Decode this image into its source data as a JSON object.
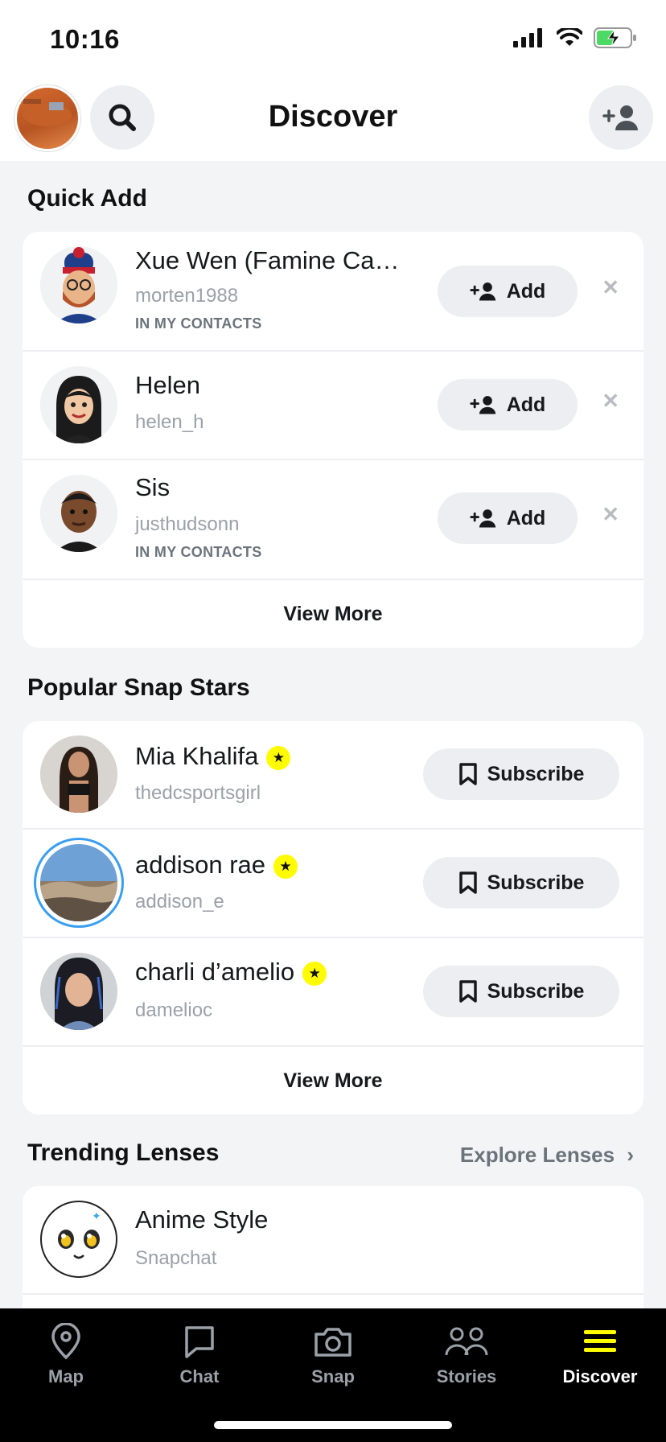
{
  "status": {
    "time": "10:16"
  },
  "header": {
    "title": "Discover"
  },
  "quick_add": {
    "title": "Quick Add",
    "items": [
      {
        "name": "Xue Wen (Famine Ca…",
        "username": "morten1988",
        "note": "IN MY CONTACTS",
        "button": "Add"
      },
      {
        "name": "Helen",
        "username": "helen_h",
        "note": "",
        "button": "Add"
      },
      {
        "name": "Sis",
        "username": "justhudsonn",
        "note": "IN MY CONTACTS",
        "button": "Add"
      }
    ],
    "view_more": "View More"
  },
  "snap_stars": {
    "title": "Popular Snap Stars",
    "items": [
      {
        "name": "Mia Khalifa",
        "username": "thedcsportsgirl",
        "button": "Subscribe"
      },
      {
        "name": "addison rae",
        "username": "addison_e",
        "button": "Subscribe"
      },
      {
        "name": "charli d’amelio",
        "username": "damelioc",
        "button": "Subscribe"
      }
    ],
    "view_more": "View More"
  },
  "lenses": {
    "title": "Trending Lenses",
    "explore": "Explore Lenses",
    "items": [
      {
        "name": "Anime Style",
        "creator": "Snapchat"
      }
    ]
  },
  "tabs": [
    {
      "label": "Map",
      "icon": "map-pin-icon"
    },
    {
      "label": "Chat",
      "icon": "chat-icon"
    },
    {
      "label": "Snap",
      "icon": "camera-icon"
    },
    {
      "label": "Stories",
      "icon": "stories-icon"
    },
    {
      "label": "Discover",
      "icon": "discover-icon",
      "active": true
    }
  ],
  "colors": {
    "accent": "#fffc00",
    "story_ring": "#3a9ef0"
  }
}
